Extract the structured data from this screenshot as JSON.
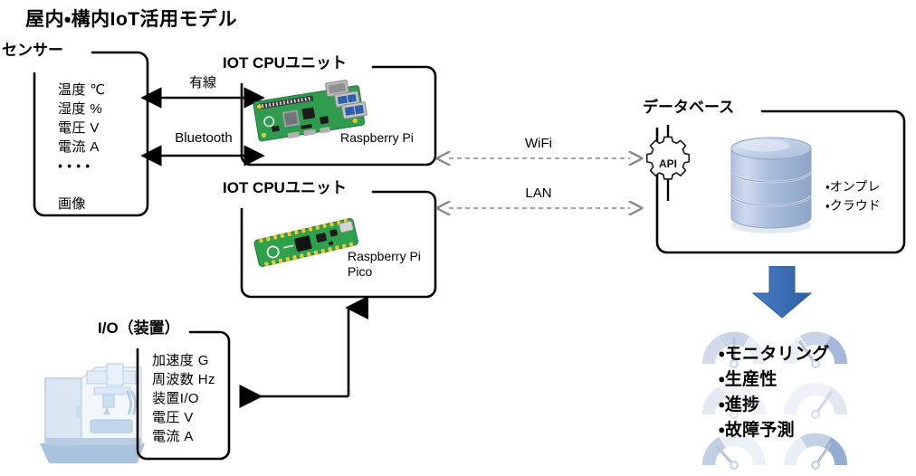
{
  "title": "屋内・構内IoT活用モデル",
  "boxes": {
    "sensor": {
      "label": "センサー",
      "items": "温度 ℃\n湿度 %\n電圧 V\n電流 A\n・ ・ ・ ・\n\n画像"
    },
    "cpu_unit_pi": {
      "label": "IOT CPUユニット",
      "caption": "Raspberry Pi",
      "board_icon": "raspberry-pi-board-icon"
    },
    "cpu_unit_pico": {
      "label": "IOT CPUユニット",
      "caption": "Raspberry Pi\nPico",
      "board_icon": "raspberry-pi-pico-board-icon"
    },
    "io_device": {
      "label": "I/O（装置）",
      "items": "加速度 G\n周波数 Hz\n装置I/O\n電圧 V\n電流 A",
      "machine_icon": "cnc-machine-icon"
    },
    "database": {
      "label": "データベース",
      "api_label": "API",
      "api_icon": "gear-api-icon",
      "db_icon": "database-cylinder-icon",
      "bullets": "・オンプレ\n・クラウド"
    }
  },
  "connections": {
    "wired": "有線",
    "bluetooth": "Bluetooth",
    "wifi": "WiFi",
    "lan": "LAN"
  },
  "outcomes": {
    "arrow_icon": "down-arrow-icon",
    "gauge_icon": "gauge-icon",
    "items": "・モニタリング\n・生産性\n・進捗\n・故障予測"
  },
  "colors": {
    "stroke": "#000000",
    "dashed_arrow": "#808080",
    "blue_arrow": "#3b6fb6",
    "machine_blue": "#b9cde5",
    "db_blue": "#93aed4",
    "gauge_blue": "#8ba4cb",
    "pcb_green": "#2f9e4f"
  }
}
